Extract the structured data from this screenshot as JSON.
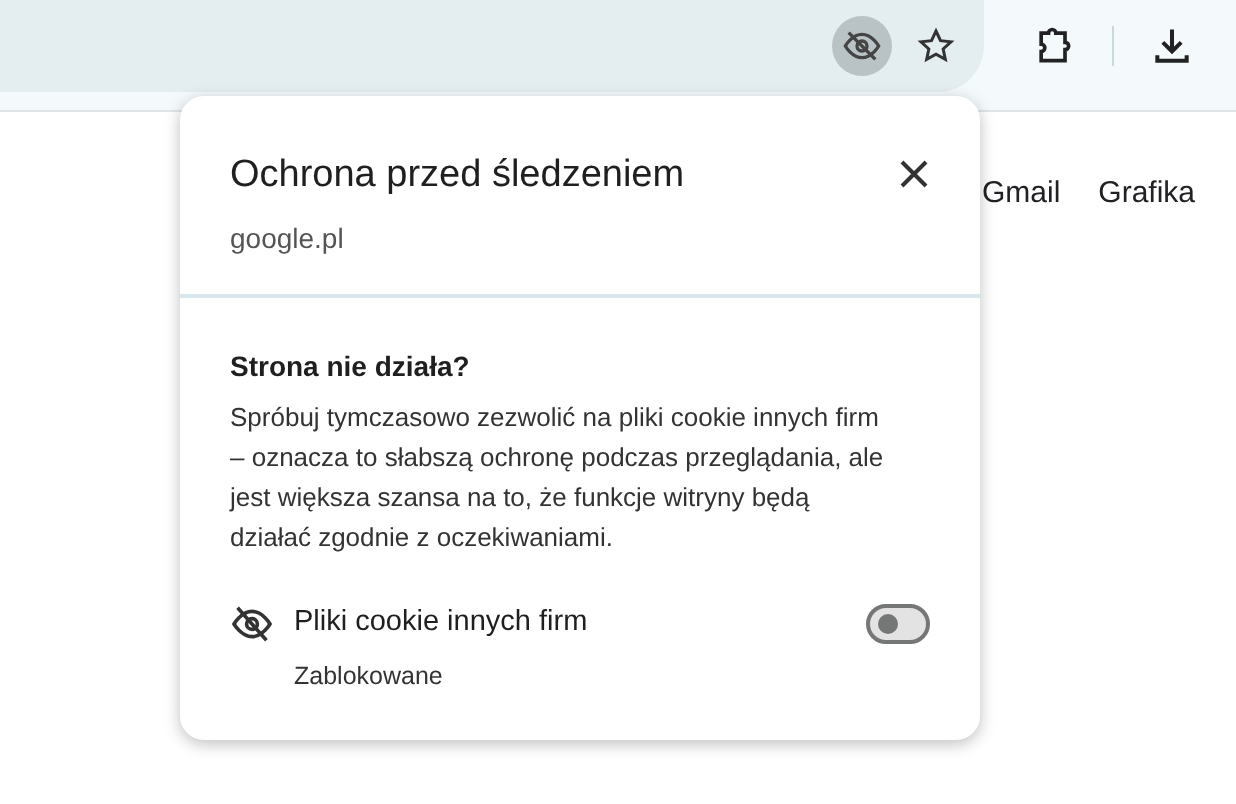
{
  "toolbar": {
    "tracking_button": {
      "selected": true
    }
  },
  "page_links": [
    "Gmail",
    "Grafika"
  ],
  "popup": {
    "title": "Ochrona przed śledzeniem",
    "site": "google.pl",
    "heading": "Strona nie działa?",
    "description": "Spróbuj tymczasowo zezwolić na pliki cookie innych firm – oznacza to słabszą ochronę podczas przeglądania, ale jest większa szansa na to, że funkcje witryny będą działać zgodnie z oczekiwaniami.",
    "setting": {
      "label": "Pliki cookie innych firm",
      "status": "Zablokowane",
      "on": false
    }
  }
}
